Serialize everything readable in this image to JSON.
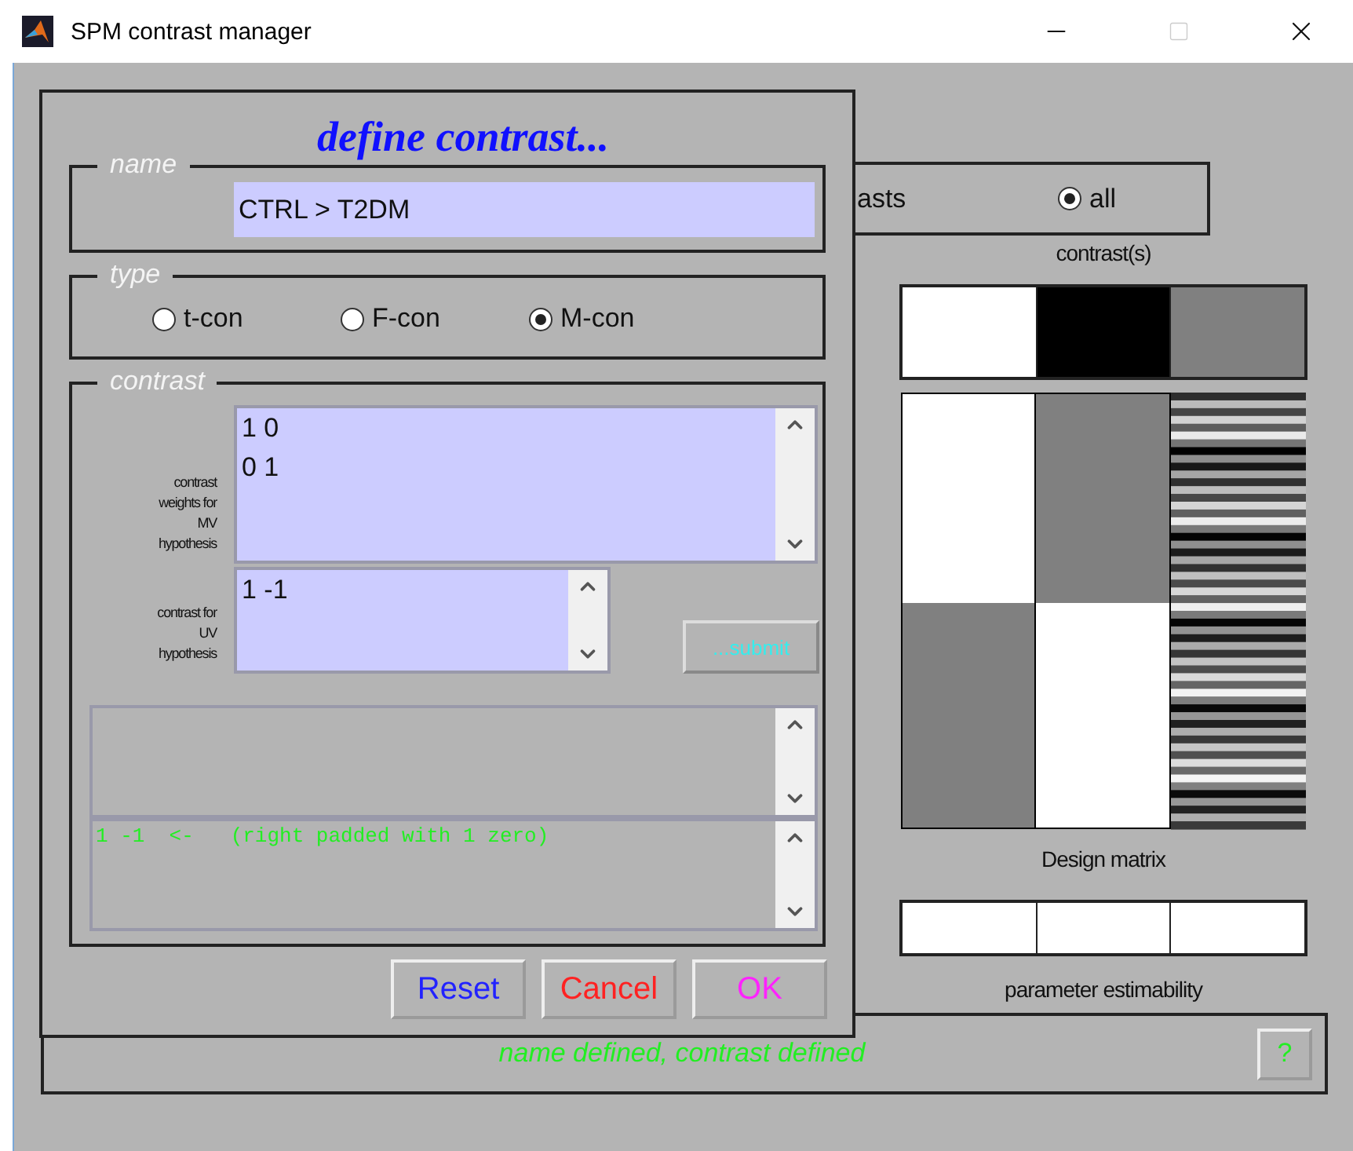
{
  "window": {
    "title": "SPM contrast manager"
  },
  "background": {
    "filter": {
      "partial_label": "asts",
      "options": [
        {
          "label": "all",
          "selected": true
        }
      ]
    },
    "contrast_label": "contrast(s)",
    "design_label": "Design matrix",
    "estimability_label": "parameter estimability"
  },
  "dialog": {
    "title": "define contrast...",
    "name": {
      "legend": "name",
      "value": "CTRL > T2DM"
    },
    "type": {
      "legend": "type",
      "options": [
        {
          "label": "t-con",
          "selected": false
        },
        {
          "label": "F-con",
          "selected": false
        },
        {
          "label": "M-con",
          "selected": true
        }
      ]
    },
    "contrast": {
      "legend": "contrast",
      "mv": {
        "label": "contrast weights for MV hypothesis",
        "value": [
          "1 0",
          "0 1"
        ]
      },
      "uv": {
        "label": "contrast for UV hypothesis",
        "value": [
          "1 -1"
        ]
      },
      "submit": "...submit",
      "messages": [
        "1 -1  <-   (right padded with 1 zero)"
      ]
    },
    "buttons": [
      {
        "label": "Reset",
        "kind": "reset"
      },
      {
        "label": "Cancel",
        "kind": "cancel"
      },
      {
        "label": "OK",
        "kind": "ok"
      }
    ]
  },
  "status_bar": {
    "message": "name defined, contrast defined",
    "help": "?"
  }
}
